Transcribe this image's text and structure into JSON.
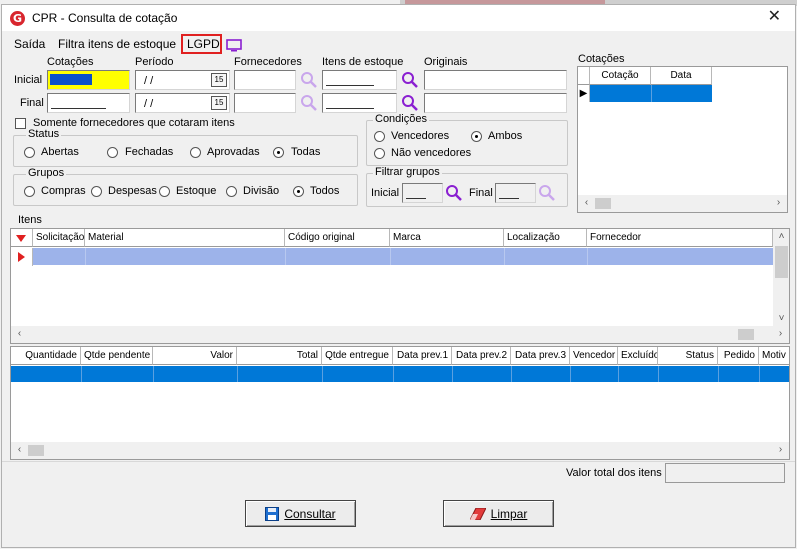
{
  "window": {
    "title": "CPR - Consulta de cotação",
    "logo_letter": "G"
  },
  "menu": {
    "items": [
      "Saída",
      "Filtra itens de estoque"
    ],
    "lgpd": "LGPD"
  },
  "filters": {
    "col_cotacoes": "Cotações",
    "col_periodo": "Período",
    "col_fornecedores": "Fornecedores",
    "col_itens": "Itens de estoque",
    "col_originais": "Originais",
    "row_inicial": "Inicial",
    "row_final": "Final",
    "date_inicial": "/ /",
    "date_final": "/ /",
    "calendar_glyph": "15"
  },
  "checkbox_somente": "Somente fornecedores que cotaram itens",
  "status": {
    "title": "Status",
    "options": [
      "Abertas",
      "Fechadas",
      "Aprovadas",
      "Todas"
    ],
    "selected": "Todas"
  },
  "condicoes": {
    "title": "Condições",
    "options": [
      "Vencedores",
      "Ambos",
      "Não vencedores"
    ],
    "selected": "Ambos"
  },
  "grupos": {
    "title": "Grupos",
    "options": [
      "Compras",
      "Despesas",
      "Estoque",
      "Divisão",
      "Todos"
    ],
    "selected": "Todos"
  },
  "filtrar_grupos": {
    "title": "Filtrar grupos",
    "inicial": "Inicial",
    "final": "Final"
  },
  "cotacoes_panel": {
    "title": "Cotações",
    "columns": [
      "Cotação",
      "Data"
    ]
  },
  "itens": {
    "title": "Itens",
    "columns": [
      "Solicitação",
      "Material",
      "Código original",
      "Marca",
      "Localização",
      "Fornecedor"
    ]
  },
  "detalhes": {
    "columns": [
      "Quantidade",
      "Qtde pendente",
      "Valor",
      "Total",
      "Qtde entregue",
      "Data prev.1",
      "Data prev.2",
      "Data prev.3",
      "Vencedor",
      "Excluído",
      "Status",
      "Pedido",
      "Motiv"
    ]
  },
  "footer": {
    "valor_total_label": "Valor total dos itens",
    "consultar": "Consultar",
    "limpar": "Limpar"
  },
  "colors": {
    "accent_blue": "#0078d7",
    "selection_light": "#9db3ea",
    "highlight_yellow": "#ffff00",
    "lgpd_border": "#e02020",
    "search_icon": "#8a1fd1"
  }
}
